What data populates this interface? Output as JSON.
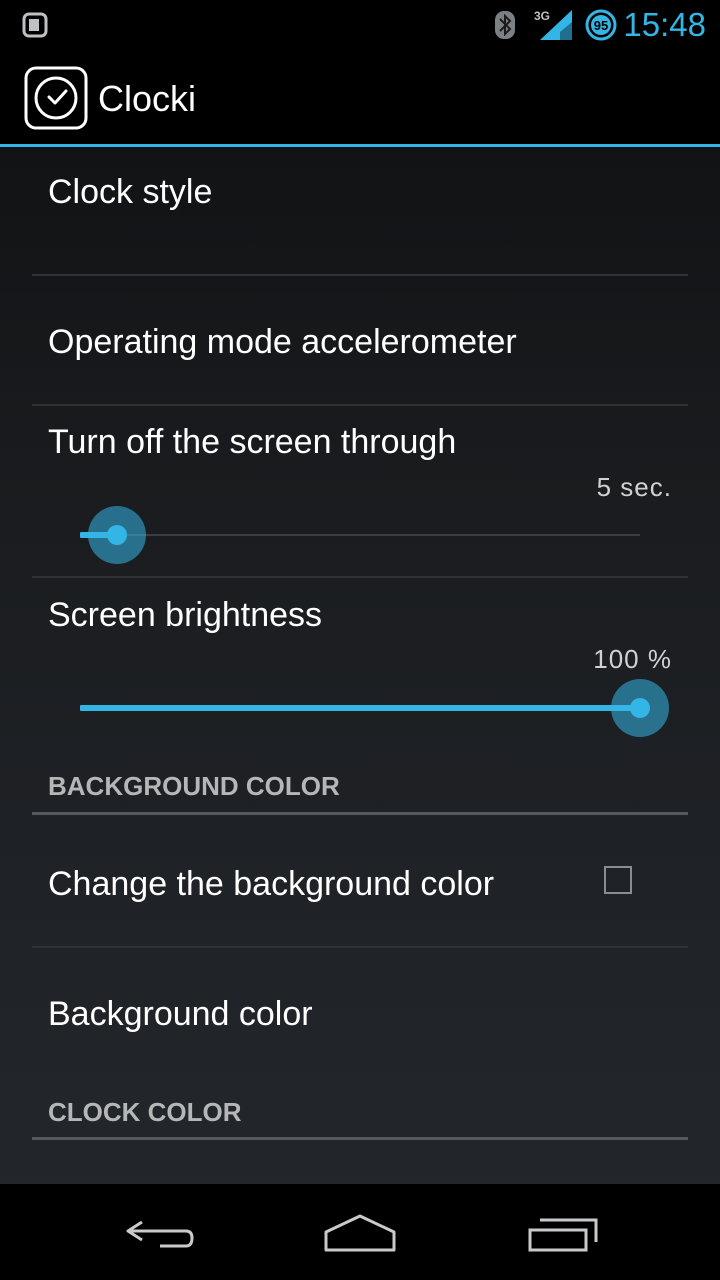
{
  "status_bar": {
    "network_label": "3G",
    "battery_level": "95",
    "time": "15:48",
    "icons": [
      "notification-icon",
      "bluetooth-icon",
      "signal-icon",
      "battery-icon"
    ]
  },
  "action_bar": {
    "app_title": "Clocki",
    "app_icon": "clock-icon"
  },
  "preferences": {
    "clock_style": "Clock style",
    "operating_mode": "Operating mode accelerometer",
    "screen_off": {
      "title": "Turn off the screen through",
      "value": "5 sec.",
      "slider_fraction": 0.0
    },
    "brightness": {
      "title": "Screen brightness",
      "value": "100 %",
      "slider_fraction": 1.0
    },
    "background_category": "BACKGROUND COLOR",
    "change_background": "Change the background color",
    "change_background_checked": false,
    "background_color": "Background color",
    "clock_color_category": "CLOCK COLOR"
  },
  "nav_bar": {
    "buttons": [
      "back-icon",
      "home-icon",
      "recents-icon"
    ]
  },
  "colors": {
    "accent": "#33b5e5",
    "background": "#1a1c1f"
  }
}
